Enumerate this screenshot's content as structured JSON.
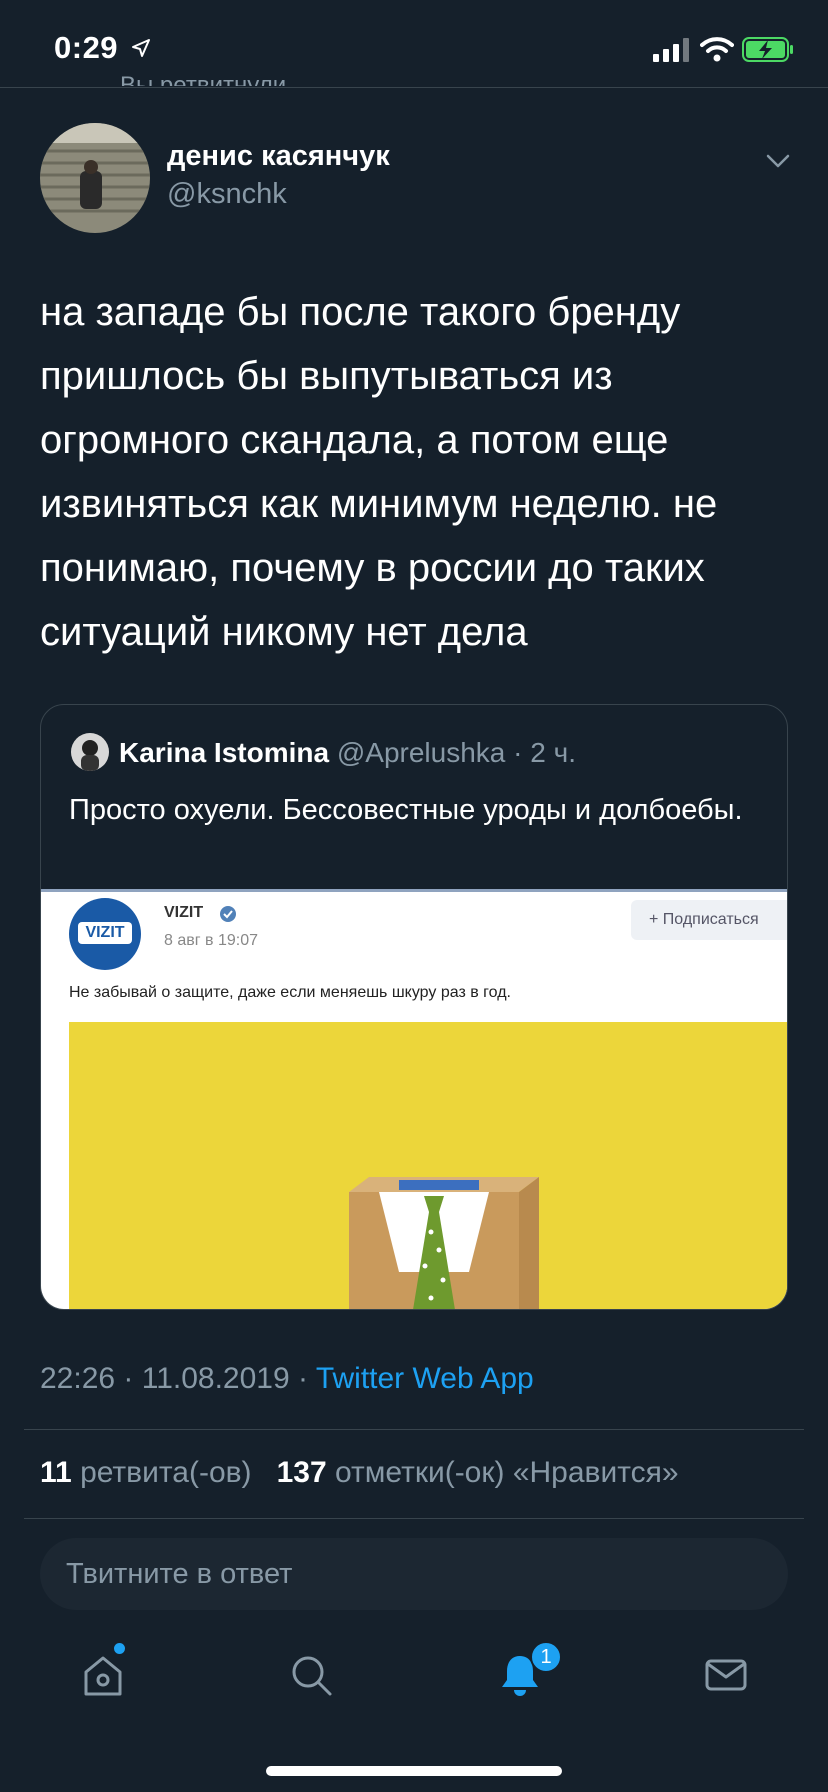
{
  "status_bar": {
    "time": "0:29"
  },
  "ghost_retweet_text": "Вы ретвитнули",
  "author": {
    "name": "денис касянчук",
    "handle": "@ksnchk"
  },
  "tweet": {
    "text": "на западе бы после такого бренду пришлось бы выпутываться из огромного скандала, а потом еще извиняться как минимум неделю. не понимаю, почему в россии до таких ситуаций никому нет дела"
  },
  "quoted_tweet": {
    "name": "Karina Istomina",
    "handle": "@Aprelushka",
    "time": "2 ч.",
    "text": "Просто охуели. Бессовестные уроды и долбоебы.",
    "image": {
      "logo_text": "VIZIT",
      "post_author": "VIZIT",
      "post_date": "8 авг в 19:07",
      "subscribe_label": "+ Подписаться",
      "caption": "Не забывай о защите, даже если меняешь шкуру раз в год.",
      "photo_bg_color": "#ecd63a"
    }
  },
  "meta": {
    "time": "22:26",
    "date": "11.08.2019",
    "source": "Twitter Web App"
  },
  "stats": {
    "retweets_count": "11",
    "retweets_label": "ретвита(-ов)",
    "likes_count": "137",
    "likes_label": "отметки(-ок) «Нравится»"
  },
  "reply": {
    "placeholder": "Твитните в ответ"
  },
  "nav": {
    "items": [
      "home",
      "search",
      "notifications",
      "messages"
    ],
    "notifications_badge": "1"
  },
  "colors": {
    "background": "#15202b",
    "accent": "#1da1f2",
    "muted": "#8899a6"
  }
}
